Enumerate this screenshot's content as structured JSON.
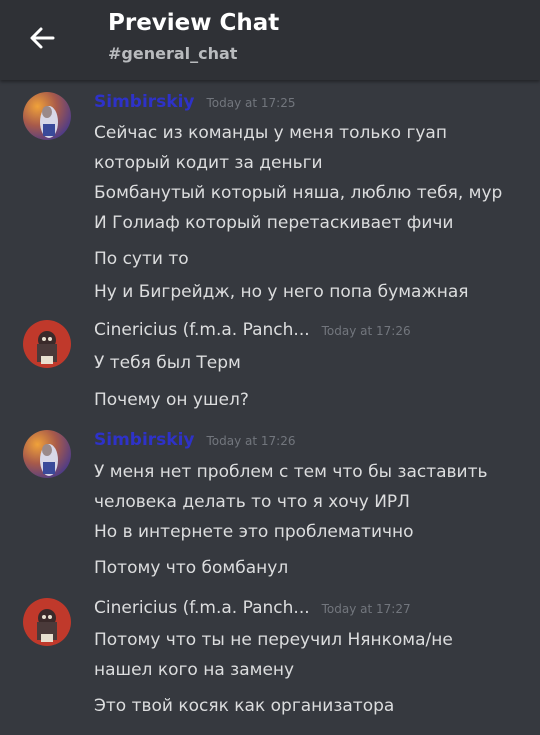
{
  "header": {
    "title": "Preview Chat",
    "channel": "#general_chat",
    "back_icon": "arrow-left-icon"
  },
  "colors": {
    "background": "#36393f",
    "header": "#2f3136",
    "simbirskiy_name": "#2e32c8",
    "text": "#dcddde",
    "timestamp": "#72767d"
  },
  "messages": [
    {
      "author": "Simbirskiy",
      "time": "Today at 17:25",
      "lines": [
        "Сейчас из команды у меня только гуап",
        "который кодит за деньги",
        "Бомбанутый который няша, люблю тебя, мур",
        "И Голиаф который перетаскивает фичи",
        "По сути то",
        "Ну и Бигрейдж, но у него попа бумажная"
      ]
    },
    {
      "author": "Cinericius (f.m.a. Panch...",
      "time": "Today at 17:26",
      "lines": [
        "У тебя был Терм",
        "Почему он ушел?"
      ]
    },
    {
      "author": "Simbirskiy",
      "time": "Today at 17:26",
      "lines": [
        "У меня нет проблем с тем что бы заставить",
        "человека делать то что я хочу ИРЛ",
        "Но в интернете это проблематично",
        "Потому что бомбанул"
      ]
    },
    {
      "author": "Cinericius (f.m.a. Panch...",
      "time": "Today at 17:27",
      "lines": [
        "Потому что ты не переучил Нянкома/не",
        "нашел кого на замену",
        "Это твой косяк как организатора"
      ]
    }
  ]
}
